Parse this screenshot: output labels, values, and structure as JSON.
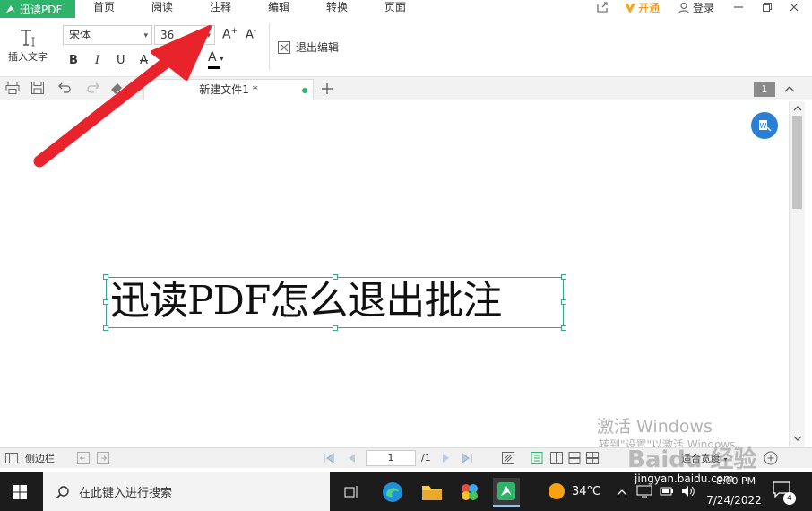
{
  "app": {
    "name": "迅读PDF"
  },
  "menu": {
    "items": [
      "首页",
      "阅读",
      "注释",
      "编辑",
      "转换",
      "页面"
    ],
    "vip_label": "开通",
    "login_label": "登录"
  },
  "ribbon": {
    "insert_text_label": "插入文字",
    "font_name": "宋体",
    "font_size": "36",
    "bold_label": "B",
    "italic_label": "I",
    "underline_label": "U",
    "strike_label": "A",
    "subscript_label": "x2",
    "color_label": "A",
    "grow_label": "A",
    "shrink_label": "A",
    "exit_edit_label": "退出编辑"
  },
  "tabs": {
    "doc_title": "新建文件1 *",
    "page_badge": "1"
  },
  "document": {
    "text": "迅读PDF怎么退出批注"
  },
  "status": {
    "sidebar_label": "侧边栏",
    "page_current": "1",
    "page_total": "/1",
    "fit_label": "适合宽度"
  },
  "watermarks": {
    "activate_title": "激活 Windows",
    "activate_sub": "转到\"设置\"以激活 Windows。",
    "baidu": "Baidu 经验",
    "jingyan": "jingyan.baidu.com"
  },
  "taskbar": {
    "search_placeholder": "在此键入进行搜索",
    "weather": "34°C",
    "time": "8:00 PM",
    "date": "7/24/2022",
    "notif_count": "4"
  },
  "colors": {
    "brand_green": "#2fb36a",
    "arrow_red": "#e8232b",
    "selection_teal": "#3aa58f",
    "taskbar": "#1c1c1c"
  }
}
